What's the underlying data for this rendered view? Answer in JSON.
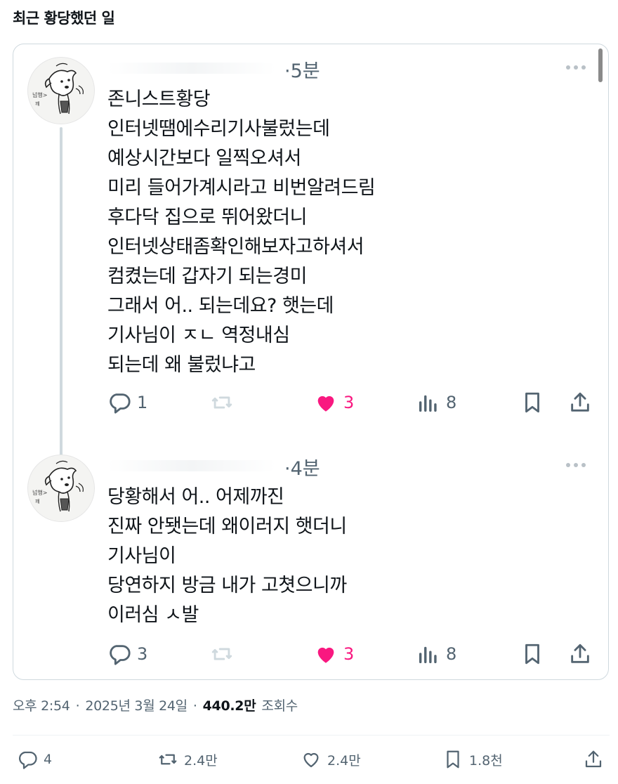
{
  "page": {
    "title": "최근 황당했던 일"
  },
  "posts": [
    {
      "timestamp": "·5분",
      "body": "존니스트황당\n인터넷땜에수리기사불렀는데\n예상시간보다 일찍오셔서\n미리 들어가계시라고 비번알려드림\n후다닥 집으로 뛰어왔더니\n인터넷상태좀확인해보자고하셔서\n컴켰는데 갑자기 되는경미\n그래서 어.. 되는데요? 햇는데\n기사님이 ㅈㄴ 역정내심\n되는데 왜 불렀냐고",
      "replies": "1",
      "likes": "3",
      "views": "8"
    },
    {
      "timestamp": "·4분",
      "body": "당황해서 어.. 어제까진\n진짜 안됏는데 왜이러지 햇더니\n기사님이\n당연하지 방금 내가 고쳣으니까\n이러심 ㅅ발",
      "replies": "3",
      "likes": "3",
      "views": "8"
    }
  ],
  "meta": {
    "time": "오후 2:54",
    "dot1": "·",
    "date": "2025년 3월 24일",
    "dot2": "·",
    "views_count": "440.2만",
    "views_label": "조회수"
  },
  "footer": {
    "replies": "4",
    "retweets": "2.4만",
    "likes": "2.4만",
    "bookmarks": "1.8천"
  },
  "colors": {
    "like": "#f91880",
    "muted": "#536471",
    "border": "#cfd9de"
  },
  "icons": [
    "reply-icon",
    "retweet-icon",
    "heart-icon",
    "views-icon",
    "bookmark-icon",
    "share-icon",
    "more-icon"
  ]
}
